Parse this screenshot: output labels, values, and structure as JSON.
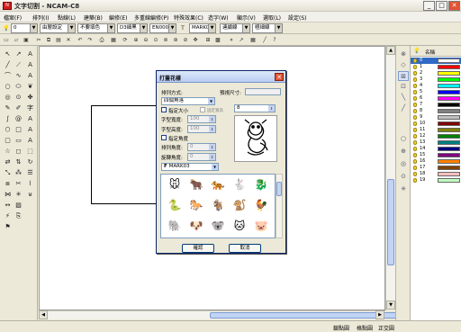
{
  "window": {
    "title": "文字切割 - NCAM-C8",
    "minimize": "_",
    "maximize": "□",
    "close": "✕"
  },
  "menu": [
    "檔案(F)",
    "排列(I)",
    "點線(L)",
    "建築(B)",
    "編修(E)",
    "多重線編修(P)",
    "特殊效果(C)",
    "造字(W)",
    "顯示(V)",
    "選取(L)",
    "設定(S)"
  ],
  "toolbar1": {
    "layer_combo": "0",
    "pen_combo": "由層設定",
    "color_combo": "不要填色",
    "font1_combo": "D3細黑",
    "font2_combo": "EN0001",
    "font3_combo": "MARK0",
    "mode_combo": "連續線",
    "style_combo": "極細線"
  },
  "layers": {
    "header": "名稱",
    "rows": [
      {
        "name": "0",
        "color": "#ffffff"
      },
      {
        "name": "1",
        "color": "#ff0000"
      },
      {
        "name": "2",
        "color": "#ffff00"
      },
      {
        "name": "3",
        "color": "#00ff00"
      },
      {
        "name": "4",
        "color": "#00ffff"
      },
      {
        "name": "5",
        "color": "#0000ff"
      },
      {
        "name": "6",
        "color": "#ff00ff"
      },
      {
        "name": "7",
        "color": "#000000"
      },
      {
        "name": "8",
        "color": "#808080"
      },
      {
        "name": "9",
        "color": "#c0c0c0"
      },
      {
        "name": "10",
        "color": "#800000"
      },
      {
        "name": "11",
        "color": "#808000"
      },
      {
        "name": "12",
        "color": "#008000"
      },
      {
        "name": "13",
        "color": "#008080"
      },
      {
        "name": "14",
        "color": "#000080"
      },
      {
        "name": "15",
        "color": "#800080"
      },
      {
        "name": "16",
        "color": "#ff8000"
      },
      {
        "name": "17",
        "color": "#804000"
      },
      {
        "name": "18",
        "color": "#ffc0c0"
      },
      {
        "name": "19",
        "color": "#c0ffc0"
      }
    ]
  },
  "status": {
    "snap_point": "鎖點圓",
    "snap_grid": "格點圓",
    "ortho": "正交圓"
  },
  "dialog": {
    "title": "打蓋花樣",
    "layout_label": "排列方式:",
    "layout_value": "四個角落",
    "size_label": "預視尺寸:",
    "fix_size_label": "指定大小",
    "fix_size_hint": "固定寬高",
    "spin_value": "8",
    "width_label": "字型寬度:",
    "width_value": "100",
    "height_label": "字型高度:",
    "height_value": "100",
    "fix_angle_label": "指定角度",
    "rot_label": "排列角度:",
    "rot_value": "0",
    "rotate_label": "旋轉角度:",
    "rotate_value": "0",
    "font_value": "MARK03",
    "ok_label": "確認",
    "cancel_label": "取消"
  },
  "colors": {
    "title_bar": "#b9cdf2",
    "dialog_border": "#0a246a",
    "scroll_thumb": "#c2d4f5"
  }
}
